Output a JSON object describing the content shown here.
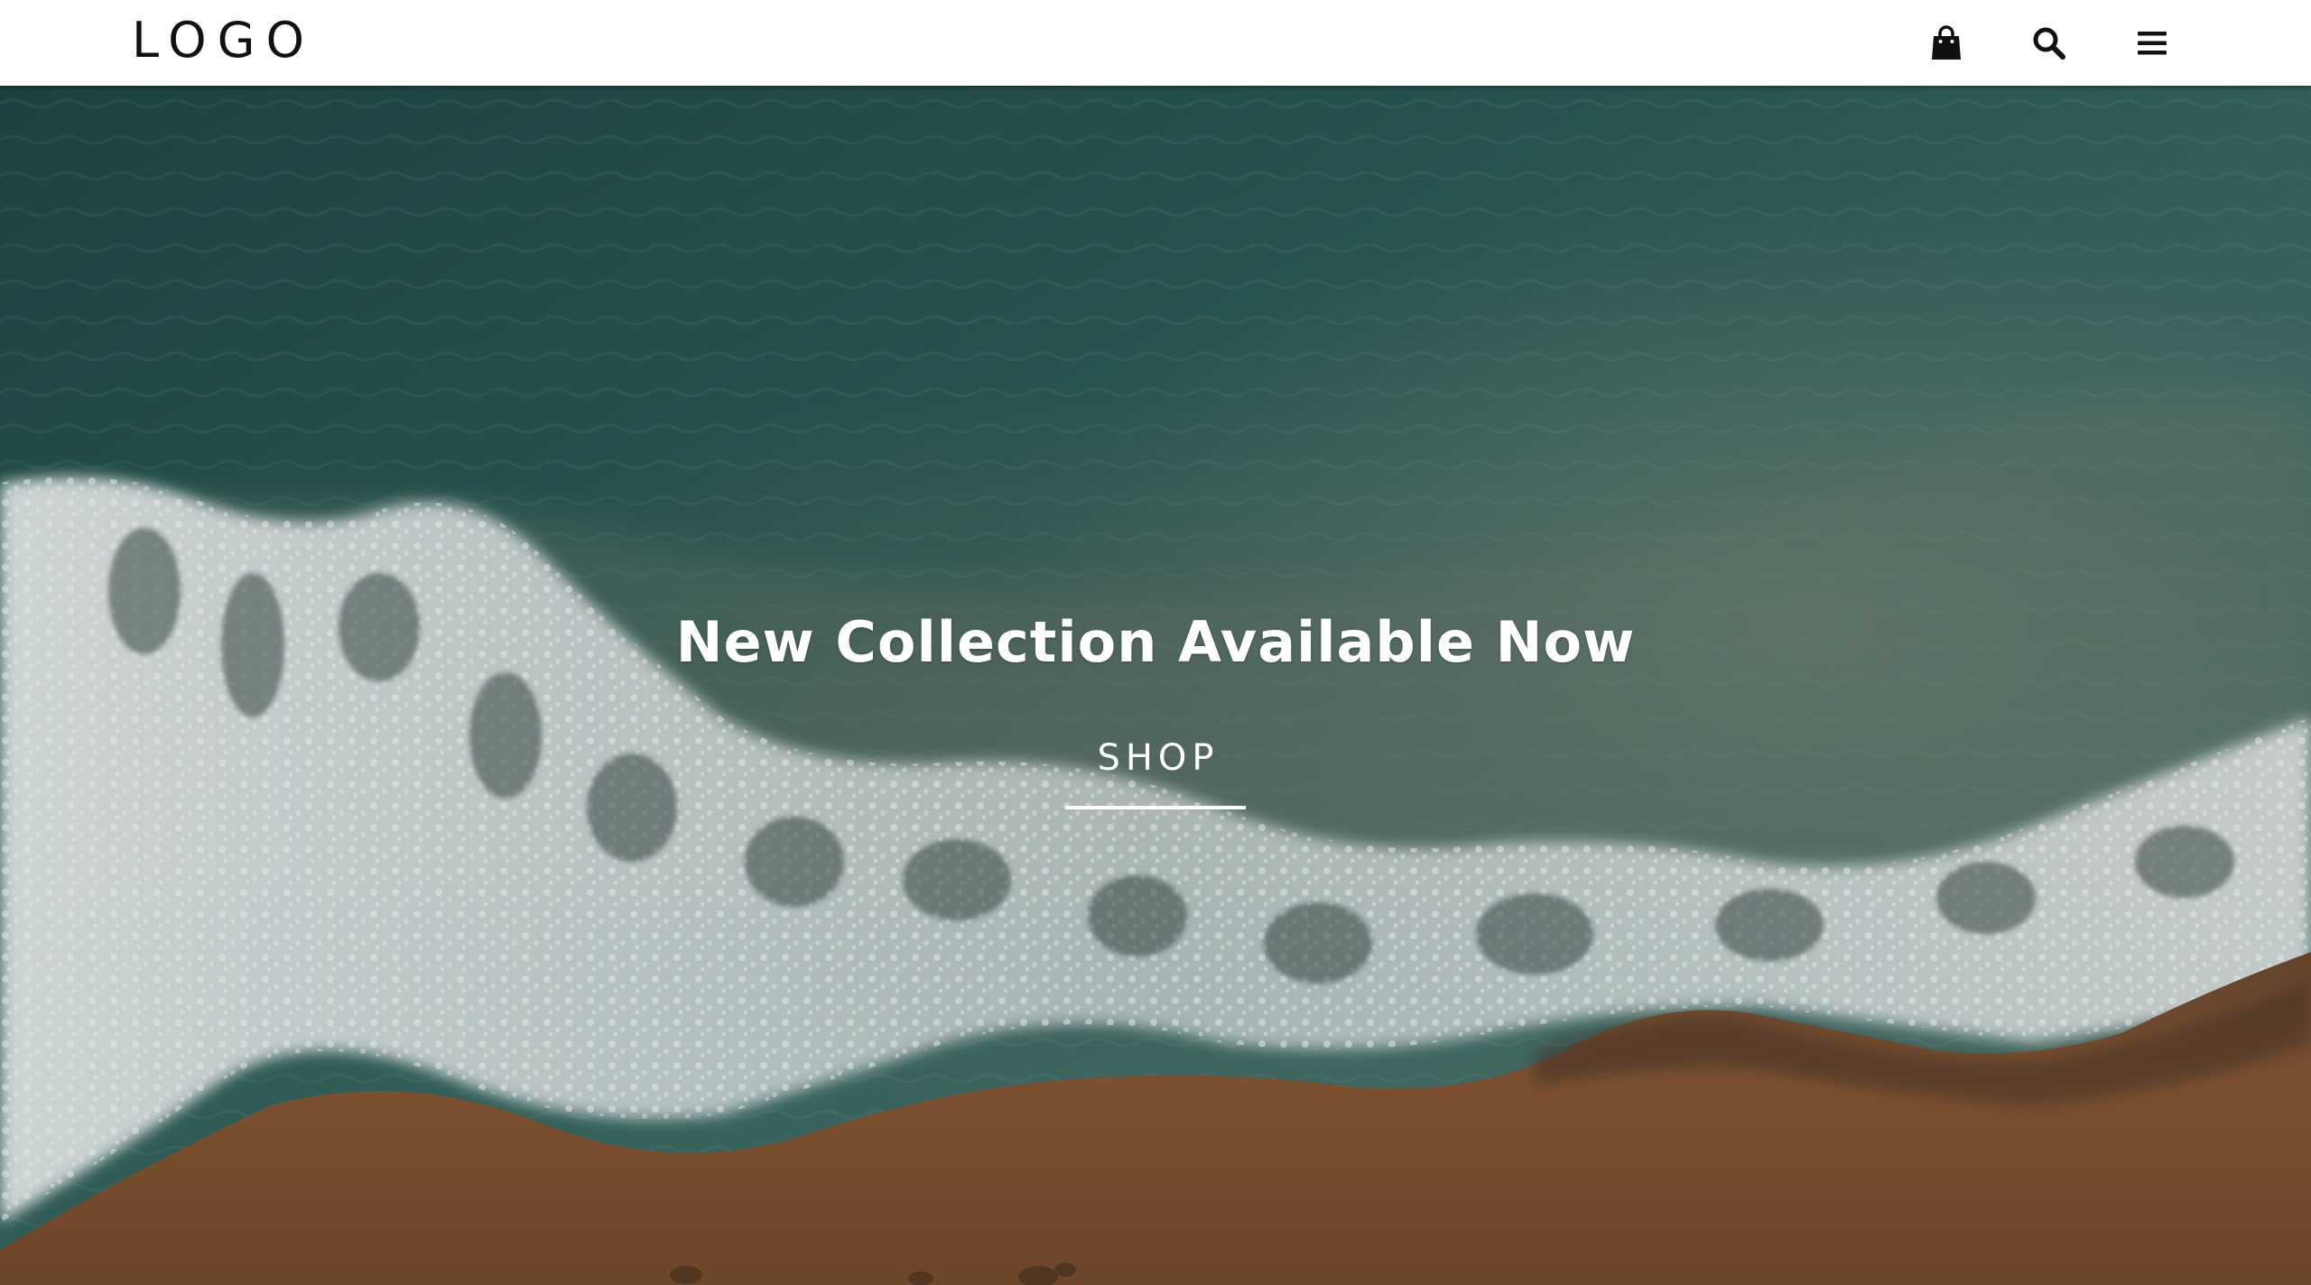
{
  "header": {
    "logo_text": "LOGO",
    "icons": [
      "shopping-bag-icon",
      "search-icon",
      "menu-icon"
    ]
  },
  "hero": {
    "title": "New Collection Available Now",
    "cta_label": "SHOP"
  },
  "colors": {
    "header_bg": "#ffffff",
    "icon_color": "#111111",
    "hero_text": "#ffffff",
    "ocean_deep": "#234b48",
    "ocean_mid": "#3d6f6b",
    "foam": "#e8eeee",
    "sand": "#8b5a35"
  }
}
